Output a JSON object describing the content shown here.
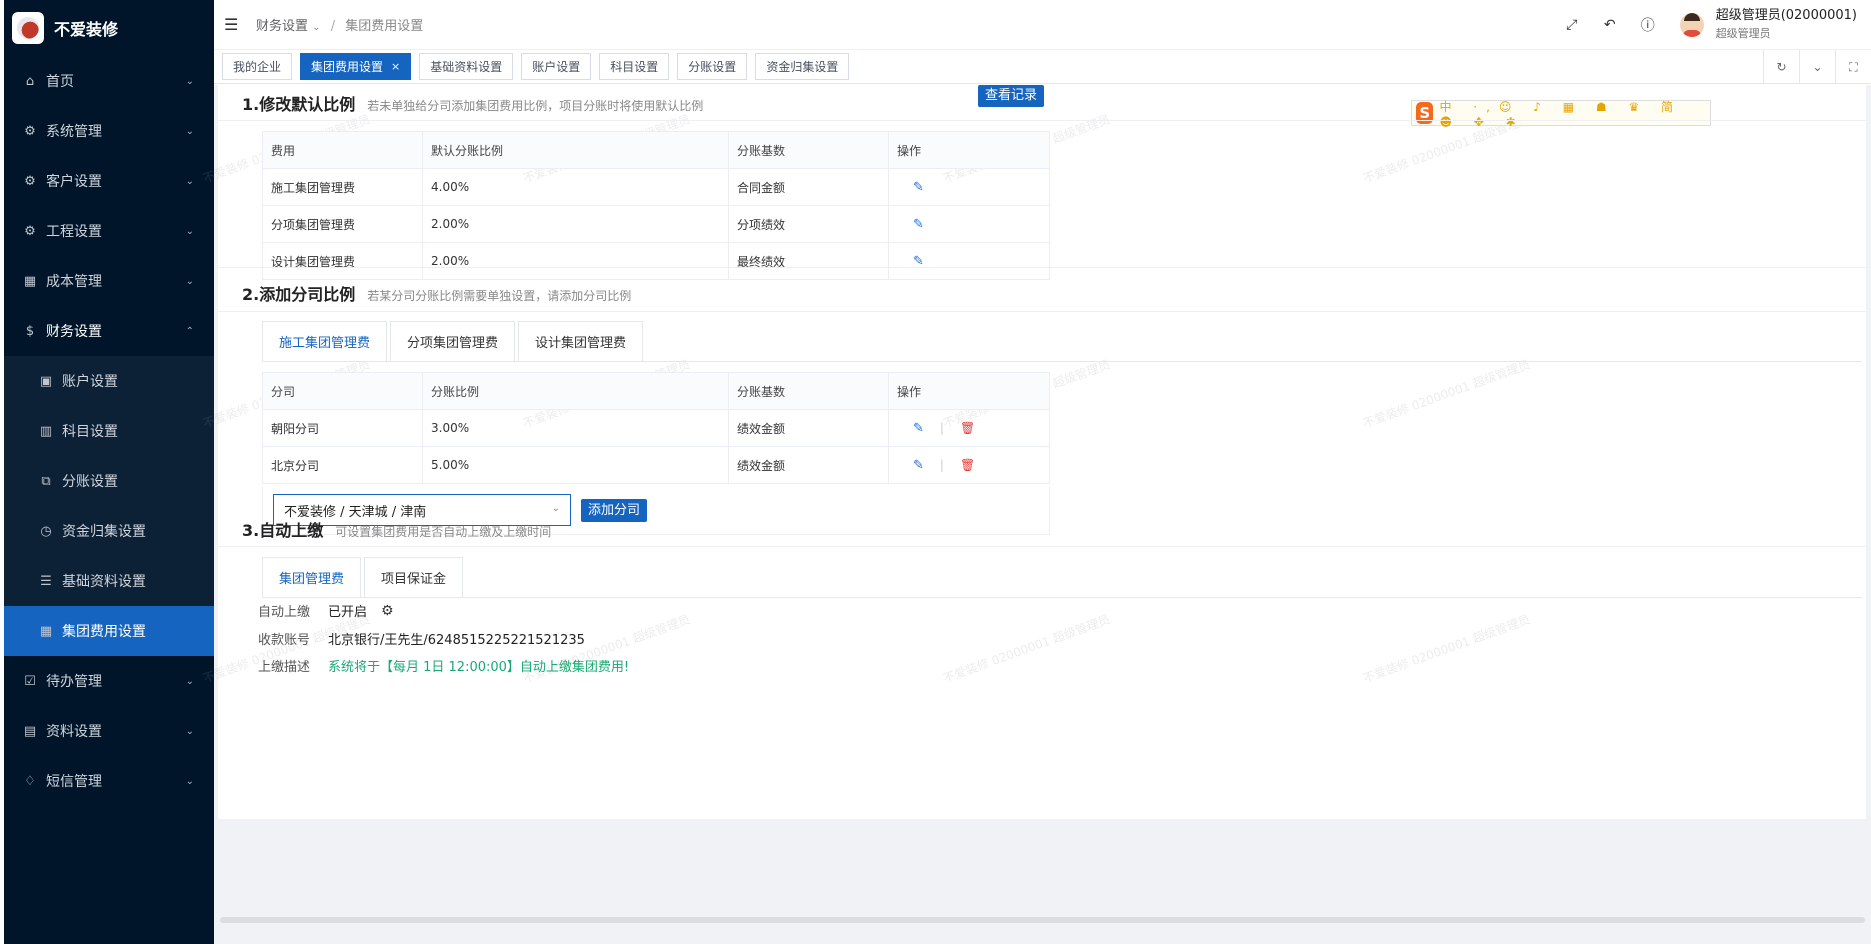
{
  "app": {
    "logo_text": "不爱装修"
  },
  "sidebar": {
    "items": [
      {
        "label": "首页",
        "icon": "home-icon"
      },
      {
        "label": "系统管理",
        "icon": "gear-icon"
      },
      {
        "label": "客户设置",
        "icon": "gear-icon"
      },
      {
        "label": "工程设置",
        "icon": "gear-icon"
      },
      {
        "label": "成本管理",
        "icon": "building-icon"
      },
      {
        "label": "财务设置",
        "icon": "dollar-icon"
      }
    ],
    "sub_items": [
      {
        "label": "账户设置",
        "icon": "account-icon"
      },
      {
        "label": "科目设置",
        "icon": "grid-icon"
      },
      {
        "label": "分账设置",
        "icon": "copy-icon"
      },
      {
        "label": "资金归集设置",
        "icon": "clock-icon"
      },
      {
        "label": "基础资料设置",
        "icon": "list-icon"
      },
      {
        "label": "集团费用设置",
        "icon": "building-icon"
      }
    ],
    "tail_items": [
      {
        "label": "待办管理",
        "icon": "todo-icon"
      },
      {
        "label": "资料设置",
        "icon": "doc-icon"
      },
      {
        "label": "短信管理",
        "icon": "bulb-icon"
      }
    ]
  },
  "header": {
    "breadcrumb_parent": "财务设置",
    "breadcrumb_current": "集团费用设置",
    "user_name": "超级管理员(02000001)",
    "user_role": "超级管理员"
  },
  "tabs": [
    {
      "label": "我的企业"
    },
    {
      "label": "集团费用设置",
      "close": "×"
    },
    {
      "label": "基础资料设置"
    },
    {
      "label": "账户设置"
    },
    {
      "label": "科目设置"
    },
    {
      "label": "分账设置"
    },
    {
      "label": "资金归集设置"
    }
  ],
  "section1": {
    "title": "1.修改默认比例",
    "hint": "若未单独给分司添加集团费用比例，项目分账时将使用默认比例",
    "btn_records": "查看记录",
    "columns": [
      "费用",
      "默认分账比例",
      "分账基数",
      "操作"
    ],
    "rows": [
      {
        "fee": "施工集团管理费",
        "ratio": "4.00%",
        "base": "合同金额"
      },
      {
        "fee": "分项集团管理费",
        "ratio": "2.00%",
        "base": "分项绩效"
      },
      {
        "fee": "设计集团管理费",
        "ratio": "2.00%",
        "base": "最终绩效"
      }
    ]
  },
  "section2": {
    "title": "2.添加分司比例",
    "hint": "若某分司分账比例需要单独设置，请添加分司比例",
    "tabs": [
      "施工集团管理费",
      "分项集团管理费",
      "设计集团管理费"
    ],
    "columns": [
      "分司",
      "分账比例",
      "分账基数",
      "操作"
    ],
    "rows": [
      {
        "branch": "朝阳分司",
        "ratio": "3.00%",
        "base": "绩效金额"
      },
      {
        "branch": "北京分司",
        "ratio": "5.00%",
        "base": "绩效金额"
      }
    ],
    "select_value": "不爱装修 / 天津城 / 津南",
    "btn_add": "添加分司"
  },
  "section3": {
    "title": "3.自动上缴",
    "hint": "可设置集团费用是否自动上缴及上缴时间",
    "tabs": [
      "集团管理费",
      "项目保证金"
    ],
    "auto_label": "自动上缴",
    "auto_value": "已开启",
    "account_label": "收款账号",
    "account_value": "北京银行/王先生/6248515225221521235",
    "desc_label": "上缴描述",
    "desc_value": "系统将于【每月 1日 12:00:00】自动上缴集团费用!"
  },
  "ime": {
    "logo": "S",
    "label": "中"
  },
  "watermark": "不爱装修 02000001 超级管理员",
  "colors": {
    "sidebar_bg": "#001529",
    "primary": "#1565c0",
    "success_text": "#19a974",
    "danger": "#e53935"
  }
}
